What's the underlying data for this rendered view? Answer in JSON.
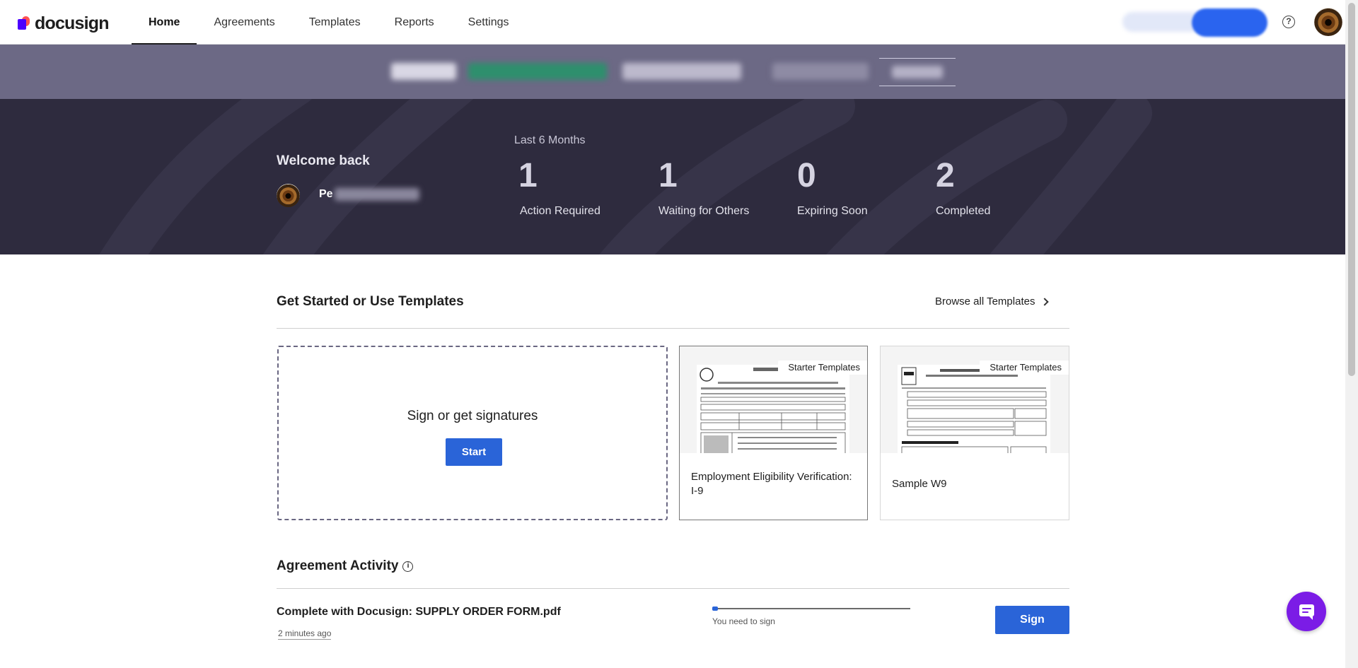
{
  "app": {
    "brand": "docusign",
    "accent_color": "#2a64d8"
  },
  "nav": {
    "tabs": [
      {
        "label": "Home",
        "active": true
      },
      {
        "label": "Agreements",
        "active": false
      },
      {
        "label": "Templates",
        "active": false
      },
      {
        "label": "Reports",
        "active": false
      },
      {
        "label": "Settings",
        "active": false
      }
    ],
    "help_symbol": "?"
  },
  "hero": {
    "welcome": "Welcome back",
    "name_visible": "Pe",
    "period": "Last 6 Months",
    "stats": [
      {
        "value": "1",
        "label": "Action Required"
      },
      {
        "value": "1",
        "label": "Waiting for Others"
      },
      {
        "value": "0",
        "label": "Expiring Soon"
      },
      {
        "value": "2",
        "label": "Completed"
      }
    ]
  },
  "get_started": {
    "title": "Get Started or Use Templates",
    "browse_label": "Browse all Templates",
    "dropzone_title": "Sign or get signatures",
    "start_label": "Start",
    "templates": [
      {
        "tag": "Starter Templates",
        "title": "Employment Eligibility Verification: I-9"
      },
      {
        "tag": "Starter Templates",
        "title": "Sample W9"
      }
    ]
  },
  "activity": {
    "title": "Agreement Activity",
    "info_symbol": "i",
    "items": [
      {
        "name": "Complete with Docusign: SUPPLY ORDER FORM.pdf",
        "time": "2 minutes ago",
        "status": "You need to sign",
        "progress": 0.03,
        "action_label": "Sign"
      }
    ]
  }
}
